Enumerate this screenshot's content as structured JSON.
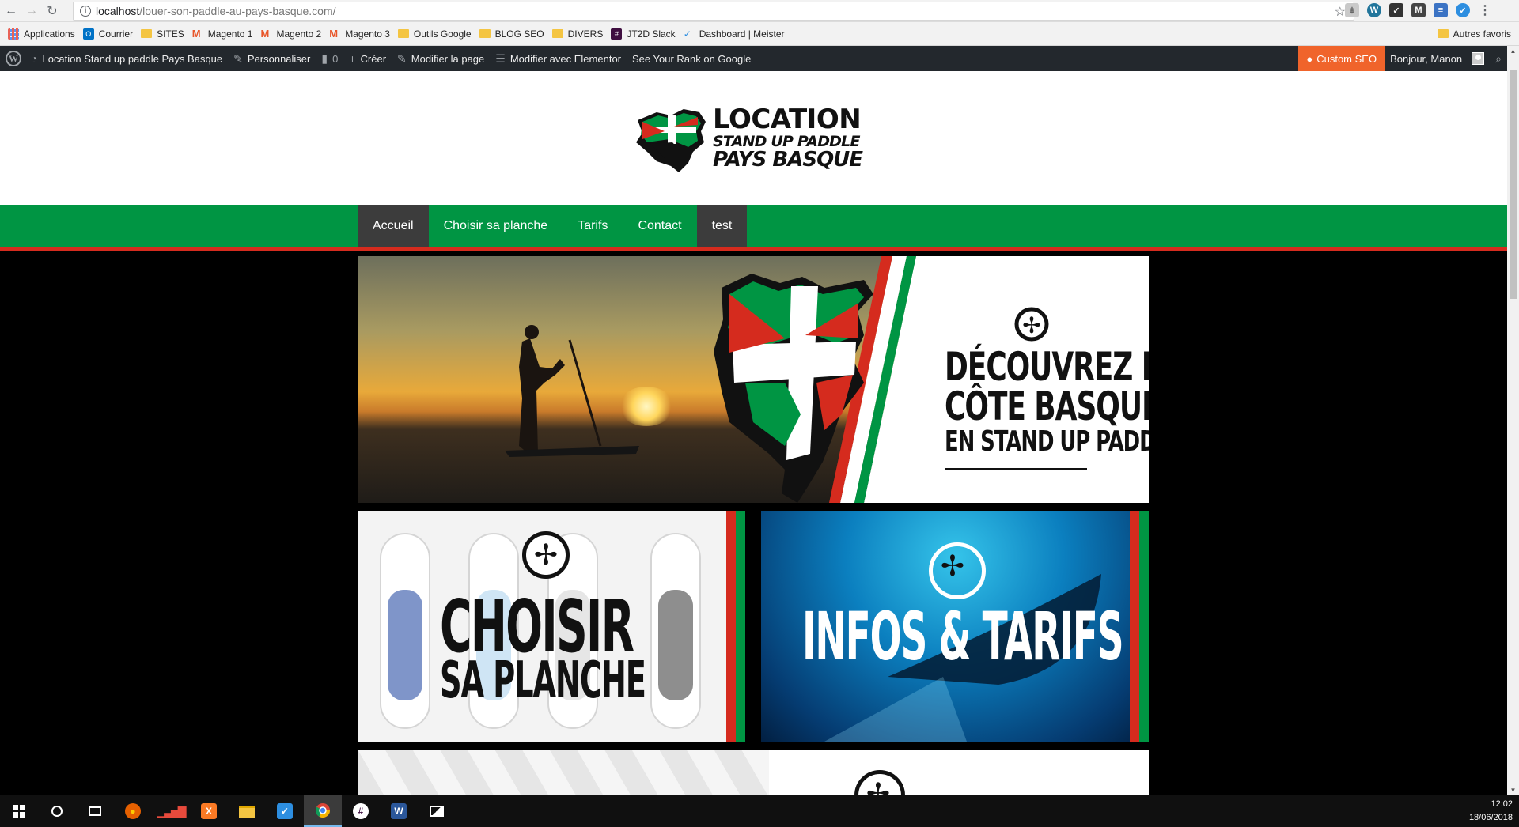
{
  "browser": {
    "url_host": "localhost",
    "url_path": "/louer-son-paddle-au-pays-basque.com/",
    "bookmarks": [
      {
        "label": "Applications",
        "icon": "apps-grid-icon"
      },
      {
        "label": "Courrier",
        "icon": "outlook-icon"
      },
      {
        "label": "SITES",
        "icon": "folder-icon"
      },
      {
        "label": "Magento 1",
        "icon": "magento-icon"
      },
      {
        "label": "Magento 2",
        "icon": "magento-icon"
      },
      {
        "label": "Magento 3",
        "icon": "magento-icon"
      },
      {
        "label": "Outils Google",
        "icon": "folder-icon"
      },
      {
        "label": "BLOG SEO",
        "icon": "folder-icon"
      },
      {
        "label": "DIVERS",
        "icon": "folder-icon"
      },
      {
        "label": "JT2D Slack",
        "icon": "slack-icon"
      },
      {
        "label": "Dashboard | Meister",
        "icon": "check-icon"
      }
    ],
    "other_bookmarks": "Autres favoris"
  },
  "admin_bar": {
    "site_name": "Location Stand up paddle Pays Basque",
    "customize": "Personnaliser",
    "comments_count": "0",
    "create": "Créer",
    "edit_page": "Modifier la page",
    "edit_elementor": "Modifier avec Elementor",
    "see_rank": "See Your Rank on Google",
    "custom_seo": "Custom SEO",
    "greeting": "Bonjour, Manon"
  },
  "site": {
    "logo": {
      "line1": "LOCATION",
      "line2": "STAND UP PADDLE",
      "line3": "PAYS BASQUE"
    },
    "nav": [
      "Accueil",
      "Choisir sa planche",
      "Tarifs",
      "Contact",
      "test"
    ],
    "hero": {
      "line1": "DÉCOUVREZ LA",
      "line2": "CÔTE BASQUE",
      "line3": "EN STAND UP PADDLE"
    },
    "tile_left": {
      "line1": "CHOISIR",
      "line2": "SA PLANCHE"
    },
    "tile_right": {
      "line1": "INFOS & TARIFS"
    }
  },
  "taskbar": {
    "time": "12:02",
    "date": "18/06/2018"
  },
  "colors": {
    "basque_green": "#009543",
    "basque_red": "#d52b1e",
    "wp_admin": "#23282d",
    "custom_seo": "#f0642b"
  }
}
